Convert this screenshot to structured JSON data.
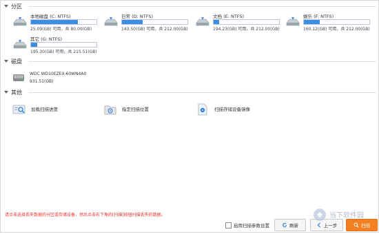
{
  "sections": {
    "partitions": "分区",
    "disks": "磁盘",
    "others": "其他"
  },
  "drives": [
    {
      "name": "本地磁盘 (C: NTFS)",
      "usage": "25.09(GB) 可用，共 80.00(GB)",
      "used_fraction": 0.72
    },
    {
      "name": "日常 (D: NTFS)",
      "usage": "143.50(GB) 可用，共 212.00(GB)",
      "used_fraction": 0.32
    },
    {
      "name": "文档 (E: NTFS)",
      "usage": "194.23(GB) 可用，共 212.00(GB)",
      "used_fraction": 0.08
    },
    {
      "name": "娱乐 (F: NTFS)",
      "usage": "160.12(GB) 可用，共 212.00(GB)",
      "used_fraction": 0.24
    },
    {
      "name": "其它 (G: NTFS)",
      "usage": "195.30(GB) 可用，共 215.51(GB)",
      "used_fraction": 0.09
    }
  ],
  "disk": {
    "name": "WDC WD10EZEX-60WN4A0",
    "size": "931.51(GB)"
  },
  "others": [
    {
      "label": "加载扫描进度",
      "icon": "load-progress-icon"
    },
    {
      "label": "指定扫描位置",
      "icon": "scan-location-icon"
    },
    {
      "label": "扫描存储设备镜像",
      "icon": "device-image-icon"
    }
  ],
  "hint": "请点击选择丢失数据的分区或存储设备，然后点击右下角的[扫描]按钮扫描丢失的数据。",
  "footer": {
    "checkbox_label": "启用扫描参数设置",
    "refresh_label": "刷新",
    "prev_label": "上一步",
    "scan_label": "扫描"
  },
  "watermark": "当下软件园",
  "colors": {
    "bar_fill": "#3d8de0",
    "hint": "#e8322e",
    "scan_button": "#f4801f"
  }
}
